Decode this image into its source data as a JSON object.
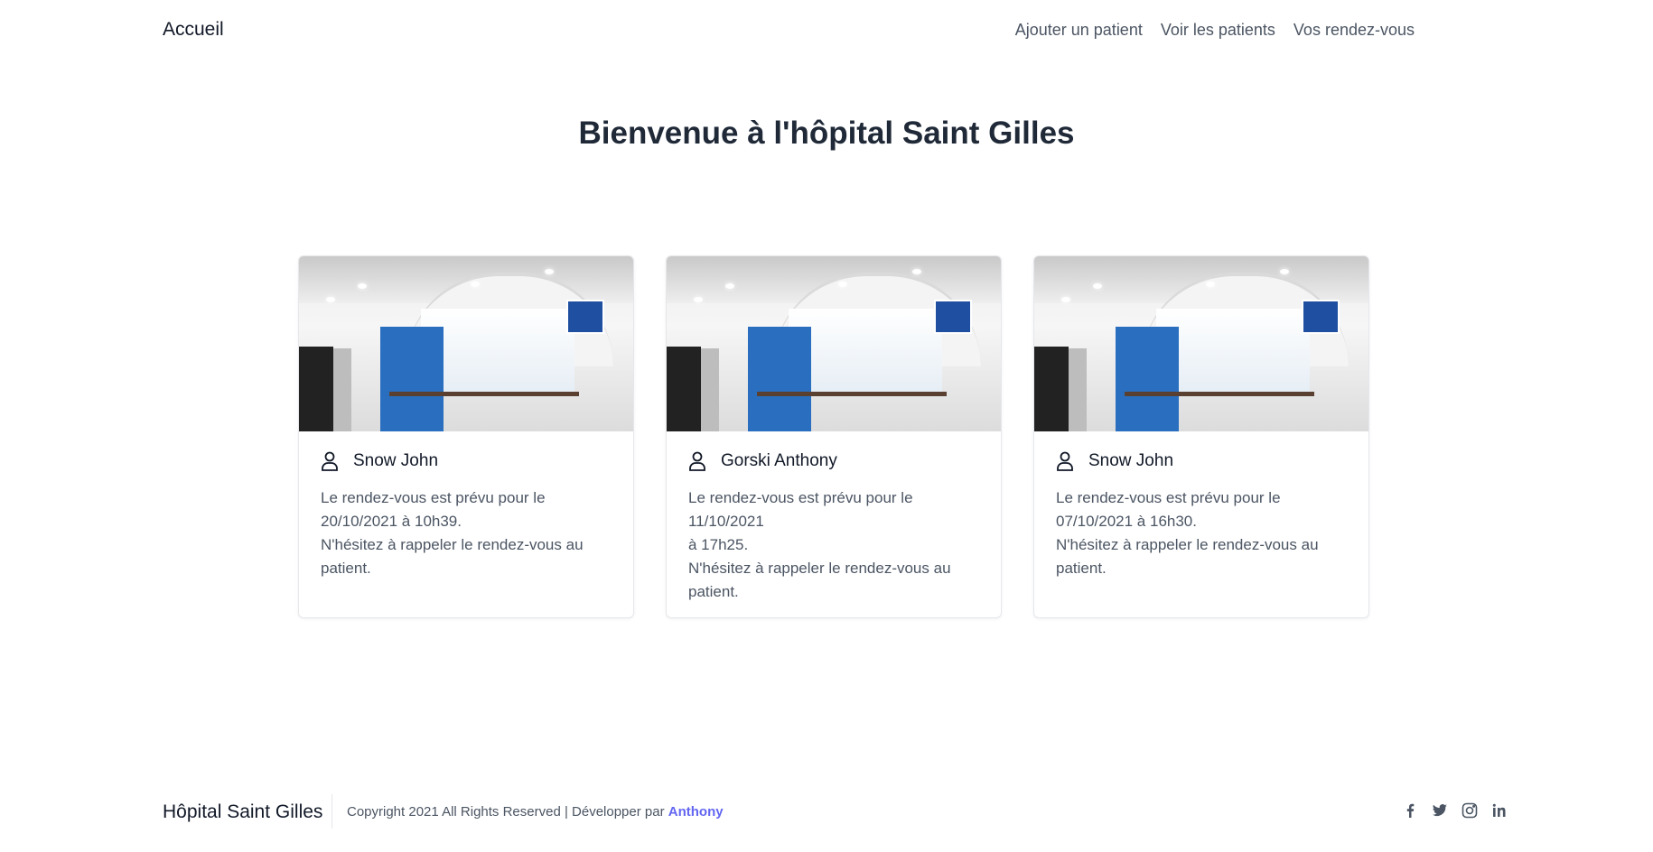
{
  "nav": {
    "brand": "Accueil",
    "links": [
      "Ajouter un patient",
      "Voir les patients",
      "Vos rendez-vous"
    ]
  },
  "hero": {
    "title": "Bienvenue à l'hôpital Saint Gilles"
  },
  "cards": [
    {
      "icon": "user-icon",
      "name": "Snow John",
      "line1": "Le rendez-vous est prévu pour le",
      "line2": "20/10/2021 à 10h39.",
      "line3": "N'hésitez à rappeler le rendez-vous au",
      "line4": "patient."
    },
    {
      "icon": "user-icon",
      "name": "Gorski Anthony",
      "line1": "Le rendez-vous est prévu pour le 11/10/2021",
      "line2": "à 17h25.",
      "line3": "N'hésitez à rappeler le rendez-vous au",
      "line4": "patient."
    },
    {
      "icon": "user-icon",
      "name": "Snow John",
      "line1": "Le rendez-vous est prévu pour le",
      "line2": "07/10/2021 à 16h30.",
      "line3": "N'hésitez à rappeler le rendez-vous au",
      "line4": "patient."
    }
  ],
  "footer": {
    "brand": "Hôpital Saint Gilles",
    "copyright": "Copyright 2021 All Rights Reserved | Développer par",
    "author": "Anthony",
    "socials": [
      "facebook-icon",
      "twitter-icon",
      "instagram-icon",
      "linkedin-icon"
    ]
  },
  "colors": {
    "accent": "#6366f1",
    "text": "#1f2937",
    "muted": "#4b5563"
  }
}
